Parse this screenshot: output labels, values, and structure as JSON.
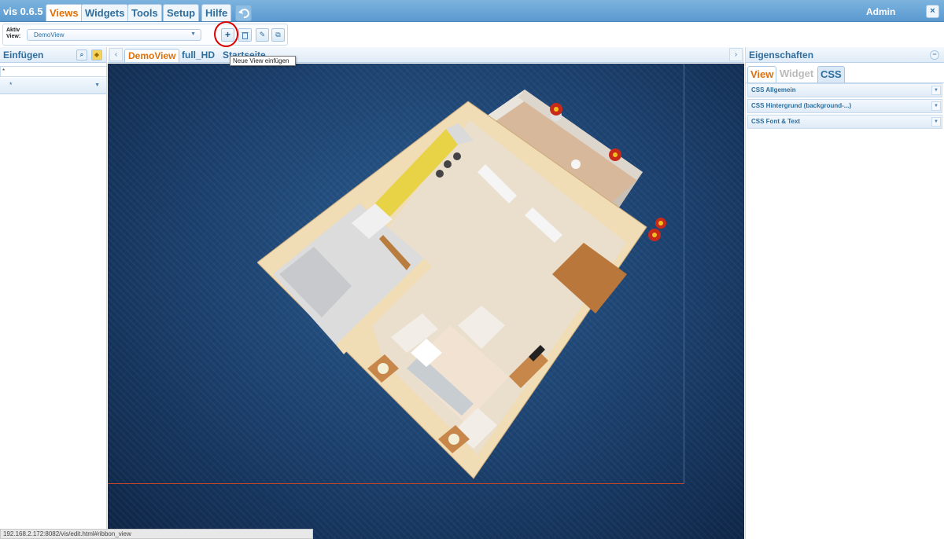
{
  "app": {
    "title": "vis 0.6.5",
    "user": "Admin",
    "close_glyph": "×"
  },
  "menu": {
    "tabs": [
      {
        "label": "Views",
        "active": true
      },
      {
        "label": "Widgets",
        "active": false
      },
      {
        "label": "Tools",
        "active": false
      },
      {
        "label": "Setup",
        "active": false
      },
      {
        "label": "Hilfe",
        "active": false
      }
    ],
    "undo_icon": "undo-icon"
  },
  "ribbon": {
    "active_view_label": "Aktiv\nView:",
    "active_view_value": "DemoView",
    "buttons": [
      {
        "name": "add-view",
        "glyph": "+",
        "icon": "plus-icon"
      },
      {
        "name": "delete-view",
        "glyph": "🗑",
        "icon": "trash-icon"
      },
      {
        "name": "rename-view",
        "glyph": "✎",
        "icon": "pencil-icon"
      },
      {
        "name": "copy-view",
        "glyph": "⧉",
        "icon": "copy-icon"
      }
    ],
    "tooltip": "Neue View einfügen"
  },
  "left_panel": {
    "title": "Einfügen",
    "filter_value": "*",
    "widget_set_value": "*",
    "icons": [
      "search-icon",
      "tag-icon"
    ]
  },
  "view_tabs": {
    "tabs": [
      {
        "label": "DemoView",
        "active": true
      },
      {
        "label": "full_HD",
        "active": false
      },
      {
        "label": "Startseite",
        "active": false
      }
    ],
    "left_arrow": "‹",
    "right_arrow": "›"
  },
  "right_panel": {
    "title": "Eigenschaften",
    "tabs": [
      {
        "label": "View",
        "state": "active"
      },
      {
        "label": "Widget",
        "state": "disabled"
      },
      {
        "label": "CSS",
        "state": "normal"
      }
    ],
    "sections": [
      {
        "label": "CSS Allgemein"
      },
      {
        "label": "CSS Hintergrund (background-...)"
      },
      {
        "label": "CSS Font & Text"
      }
    ]
  },
  "status_bar": {
    "url": "192.168.2.172:8082/vis/edit.html#ribbon_view"
  },
  "colors": {
    "accent_orange": "#e17009",
    "primary_blue": "#2e6e9e",
    "topbar_blue": "#5a99cf",
    "highlight_red": "#dd0000",
    "canvas_dark": "#1b3f6c"
  }
}
